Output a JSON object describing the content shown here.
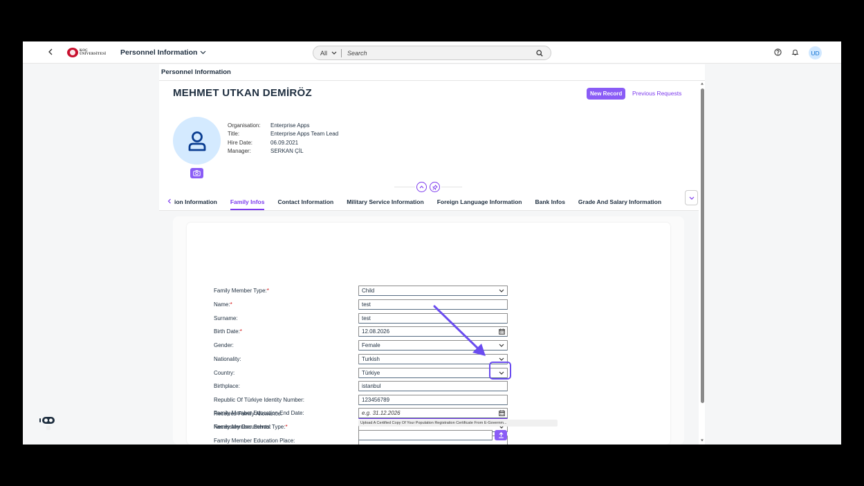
{
  "shell": {
    "logo_text_line1": "KOÇ",
    "logo_text_line2": "ÜNİVERSİTESİ",
    "app_title": "Personnel Information",
    "search_scope": "All",
    "search_placeholder": "Search",
    "user_initials": "UD"
  },
  "page": {
    "section_title": "Personnel Information",
    "employee_name": "MEHMET UTKAN DEMİRÖZ",
    "new_record_label": "New Record",
    "previous_requests_label": "Previous Requests",
    "info": [
      {
        "label": "Organisation:",
        "value": "Enterprise Apps"
      },
      {
        "label": "Title:",
        "value": "Enterprise Apps Team Lead"
      },
      {
        "label": "Hire Date:",
        "value": "06.09.2021"
      },
      {
        "label": "Manager:",
        "value": "SERKAN ÇİL"
      }
    ]
  },
  "tabs": [
    {
      "label": "ion Information",
      "active": false
    },
    {
      "label": "Family Infos",
      "active": true
    },
    {
      "label": "Contact Information",
      "active": false
    },
    {
      "label": "Military Service Information",
      "active": false
    },
    {
      "label": "Foreign Language Information",
      "active": false
    },
    {
      "label": "Bank Infos",
      "active": false
    },
    {
      "label": "Grade And Salary Information",
      "active": false
    }
  ],
  "form": {
    "family_member_type": {
      "label": "Family Member Type:",
      "value": "Child"
    },
    "name": {
      "label": "Name:",
      "value": "test"
    },
    "surname": {
      "label": "Surname:",
      "value": "test"
    },
    "birth_date": {
      "label": "Birth Date:",
      "value": "12.08.2026"
    },
    "gender": {
      "label": "Gender:",
      "value": "Female"
    },
    "nationality": {
      "label": "Nationality:",
      "value": "Turkish"
    },
    "country": {
      "label": "Country:",
      "value": "Türkiye"
    },
    "birthplace": {
      "label": "Birthplace:",
      "value": "istanbul"
    },
    "identity_number": {
      "label": "Republic Of Türkiye Identity Number:",
      "value": "123456789"
    },
    "family_allowance": {
      "label": "Receives Family Allowance:",
      "value": ""
    },
    "school_type": {
      "label": "Family Member School Type:",
      "value": ""
    },
    "education_place": {
      "label": "Family Member Education Place:",
      "value": ""
    },
    "education_end_date": {
      "label": "Family Member Education End Date:",
      "placeholder": "e.g. 31.12.2026"
    },
    "necessary_documents": {
      "label": "Necessary Documents:",
      "hint": "Upload A Certified Copy Of Your Population Registration Certificate From E-Governm..."
    }
  },
  "colors": {
    "accent": "#7c3aed",
    "button": "#8a5cf6",
    "highlight": "#6a4cf0",
    "required": "#d20a0a"
  }
}
